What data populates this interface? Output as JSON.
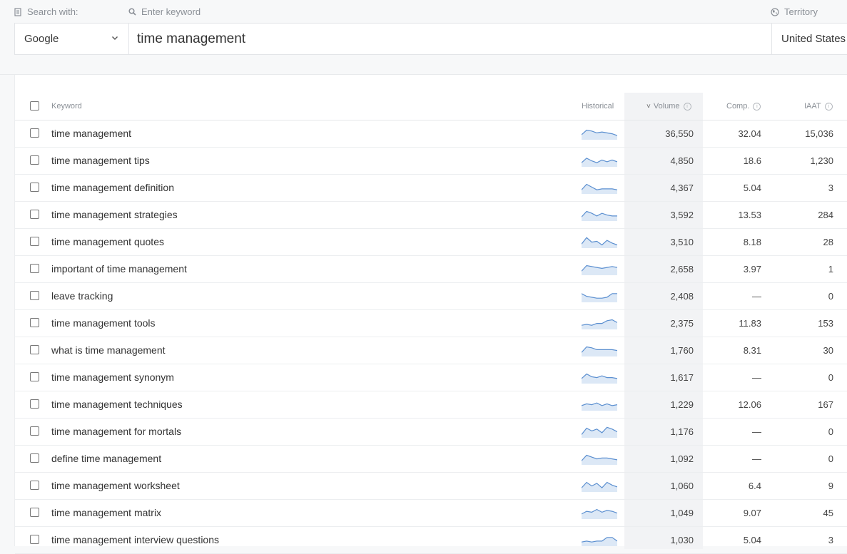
{
  "search": {
    "search_with_label": "Search with:",
    "keyword_label": "Enter keyword",
    "territory_label": "Territory",
    "engine_value": "Google",
    "keyword_value": "time management",
    "territory_value": "United States"
  },
  "table": {
    "headers": {
      "keyword": "Keyword",
      "historical": "Historical",
      "volume": "Volume",
      "comp": "Comp.",
      "iaat": "IAAT"
    },
    "sort_indicator": "˅",
    "info_glyph": "i",
    "sparkline_color": "#5b8fd0",
    "sparkline_fill": "#dce8f6",
    "rows": [
      {
        "keyword": "time management",
        "volume": "36,550",
        "comp": "32.04",
        "iaat": "15,036",
        "trend": [
          4,
          9,
          8,
          6,
          7,
          6,
          5,
          3
        ]
      },
      {
        "keyword": "time management tips",
        "volume": "4,850",
        "comp": "18.6",
        "iaat": "1,230",
        "trend": [
          3,
          8,
          5,
          3,
          6,
          4,
          6,
          4
        ]
      },
      {
        "keyword": "time management definition",
        "volume": "4,367",
        "comp": "5.04",
        "iaat": "3",
        "trend": [
          3,
          9,
          6,
          3,
          4,
          4,
          4,
          3
        ]
      },
      {
        "keyword": "time management strategies",
        "volume": "3,592",
        "comp": "13.53",
        "iaat": "284",
        "trend": [
          3,
          9,
          7,
          4,
          7,
          5,
          4,
          4
        ]
      },
      {
        "keyword": "time management quotes",
        "volume": "3,510",
        "comp": "8.18",
        "iaat": "28",
        "trend": [
          3,
          10,
          5,
          6,
          2,
          7,
          4,
          2
        ]
      },
      {
        "keyword": "important of time management",
        "volume": "2,658",
        "comp": "3.97",
        "iaat": "1",
        "trend": [
          3,
          9,
          8,
          7,
          6,
          7,
          8,
          7
        ]
      },
      {
        "keyword": "leave tracking",
        "volume": "2,408",
        "comp": "—",
        "iaat": "0",
        "trend": [
          8,
          5,
          4,
          3,
          3,
          4,
          8,
          8
        ]
      },
      {
        "keyword": "time management tools",
        "volume": "2,375",
        "comp": "11.83",
        "iaat": "153",
        "trend": [
          3,
          4,
          3,
          5,
          5,
          8,
          9,
          6
        ]
      },
      {
        "keyword": "what is time management",
        "volume": "1,760",
        "comp": "8.31",
        "iaat": "30",
        "trend": [
          3,
          9,
          8,
          6,
          6,
          6,
          6,
          5
        ]
      },
      {
        "keyword": "time management synonym",
        "volume": "1,617",
        "comp": "—",
        "iaat": "0",
        "trend": [
          4,
          9,
          6,
          5,
          7,
          5,
          5,
          4
        ]
      },
      {
        "keyword": "time management techniques",
        "volume": "1,229",
        "comp": "12.06",
        "iaat": "167",
        "trend": [
          4,
          6,
          5,
          7,
          4,
          6,
          4,
          5
        ]
      },
      {
        "keyword": "time management for mortals",
        "volume": "1,176",
        "comp": "—",
        "iaat": "0",
        "trend": [
          2,
          9,
          6,
          8,
          4,
          10,
          8,
          5
        ]
      },
      {
        "keyword": "define time management",
        "volume": "1,092",
        "comp": "—",
        "iaat": "0",
        "trend": [
          3,
          9,
          7,
          5,
          6,
          6,
          5,
          4
        ]
      },
      {
        "keyword": "time management worksheet",
        "volume": "1,060",
        "comp": "6.4",
        "iaat": "9",
        "trend": [
          3,
          9,
          5,
          8,
          3,
          9,
          6,
          4
        ]
      },
      {
        "keyword": "time management matrix",
        "volume": "1,049",
        "comp": "9.07",
        "iaat": "45",
        "trend": [
          4,
          7,
          6,
          9,
          6,
          8,
          7,
          5
        ]
      },
      {
        "keyword": "time management interview questions",
        "volume": "1,030",
        "comp": "5.04",
        "iaat": "3",
        "trend": [
          3,
          4,
          3,
          4,
          4,
          8,
          8,
          4
        ]
      }
    ]
  }
}
